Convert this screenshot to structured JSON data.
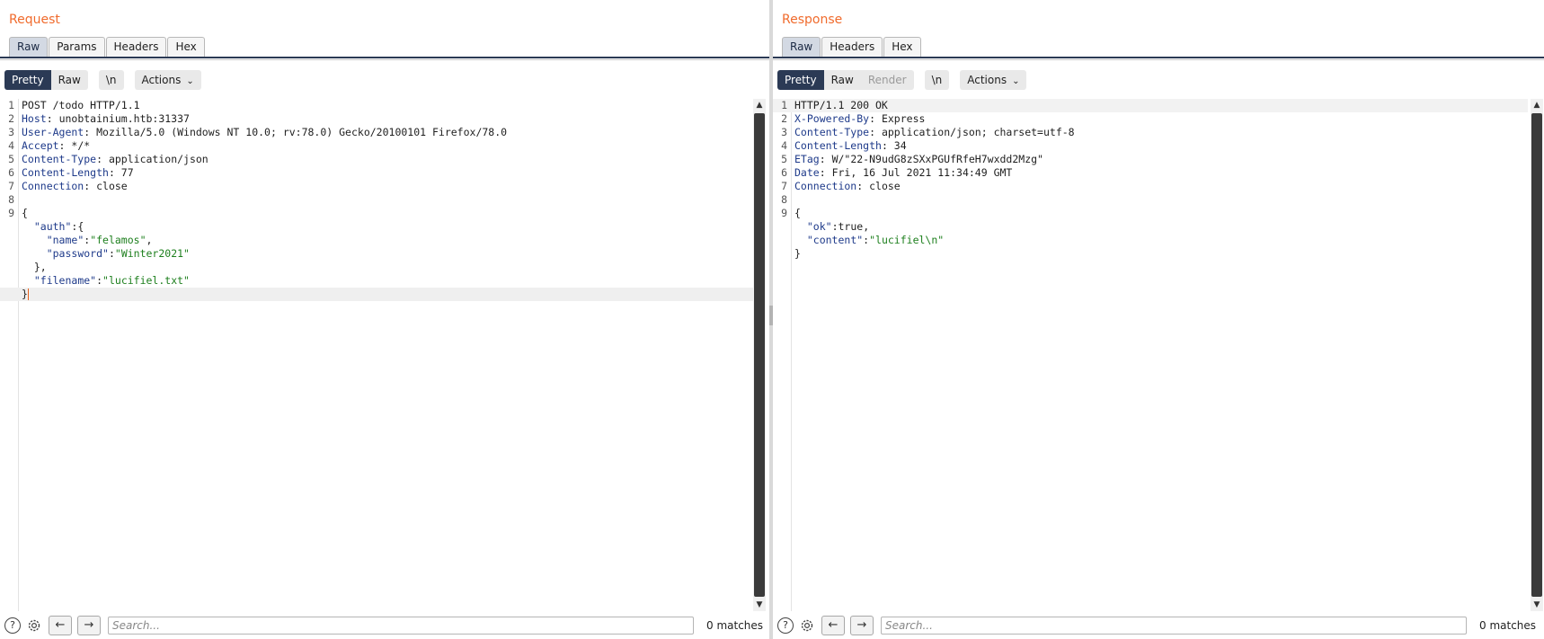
{
  "request": {
    "title": "Request",
    "tabs": [
      "Raw",
      "Params",
      "Headers",
      "Hex"
    ],
    "active_tab": "Raw",
    "view_buttons": [
      "Pretty",
      "Raw"
    ],
    "newline_button": "\\n",
    "actions_label": "Actions",
    "lines": [
      {
        "n": "1",
        "plain": "POST /todo HTTP/1.1"
      },
      {
        "n": "2",
        "key": "Host",
        "value": "unobtainium.htb:31337"
      },
      {
        "n": "3",
        "key": "User-Agent",
        "value": "Mozilla/5.0 (Windows NT 10.0; rv:78.0) Gecko/20100101 Firefox/78.0"
      },
      {
        "n": "4",
        "key": "Accept",
        "value": "*/*"
      },
      {
        "n": "5",
        "key": "Content-Type",
        "value": "application/json"
      },
      {
        "n": "6",
        "key": "Content-Length",
        "value": "77"
      },
      {
        "n": "7",
        "key": "Connection",
        "value": "close"
      },
      {
        "n": "8",
        "plain": ""
      },
      {
        "n": "9",
        "plain": "{"
      },
      {
        "n": "",
        "indent": "  ",
        "jkey": "\"auth\"",
        "rest": ":{"
      },
      {
        "n": "",
        "indent": "    ",
        "jkey": "\"name\"",
        "sep": ":",
        "jval": "\"felamos\"",
        "rest": ","
      },
      {
        "n": "",
        "indent": "    ",
        "jkey": "\"password\"",
        "sep": ":",
        "jval": "\"Winter2021\""
      },
      {
        "n": "",
        "plain": "  },"
      },
      {
        "n": "",
        "indent": "  ",
        "jkey": "\"filename\"",
        "sep": ":",
        "jval": "\"lucifiel.txt\""
      },
      {
        "n": "",
        "plain": "}",
        "cursor": true
      }
    ],
    "search_placeholder": "Search...",
    "matches": "0 matches"
  },
  "response": {
    "title": "Response",
    "tabs": [
      "Raw",
      "Headers",
      "Hex"
    ],
    "active_tab": "Raw",
    "view_buttons": [
      "Pretty",
      "Raw",
      "Render"
    ],
    "newline_button": "\\n",
    "actions_label": "Actions",
    "lines": [
      {
        "n": "1",
        "plain": "HTTP/1.1 200 OK"
      },
      {
        "n": "2",
        "key": "X-Powered-By",
        "value": "Express"
      },
      {
        "n": "3",
        "key": "Content-Type",
        "value": "application/json; charset=utf-8"
      },
      {
        "n": "4",
        "key": "Content-Length",
        "value": "34"
      },
      {
        "n": "5",
        "key": "ETag",
        "value": "W/\"22-N9udG8zSXxPGUfRfeH7wxdd2Mzg\""
      },
      {
        "n": "6",
        "key": "Date",
        "value": "Fri, 16 Jul 2021 11:34:49 GMT"
      },
      {
        "n": "7",
        "key": "Connection",
        "value": "close"
      },
      {
        "n": "8",
        "plain": ""
      },
      {
        "n": "9",
        "plain": "{"
      },
      {
        "n": "",
        "indent": "  ",
        "jkey": "\"ok\"",
        "sep": ":",
        "jval": "true",
        "rest": ",",
        "jval_plain": true
      },
      {
        "n": "",
        "indent": "  ",
        "jkey": "\"content\"",
        "sep": ":",
        "jval": "\"lucifiel\\n\""
      },
      {
        "n": "",
        "plain": "}"
      }
    ],
    "search_placeholder": "Search...",
    "matches": "0 matches"
  },
  "icons": {
    "help": "help-icon",
    "settings": "gear-icon",
    "back": "arrow-left-icon",
    "forward": "arrow-right-icon"
  },
  "colors": {
    "title_orange": "#f06b2d",
    "active_navy": "#2b3a55",
    "header_key_blue": "#1e3a8a",
    "json_string_green": "#1d7f1d"
  }
}
